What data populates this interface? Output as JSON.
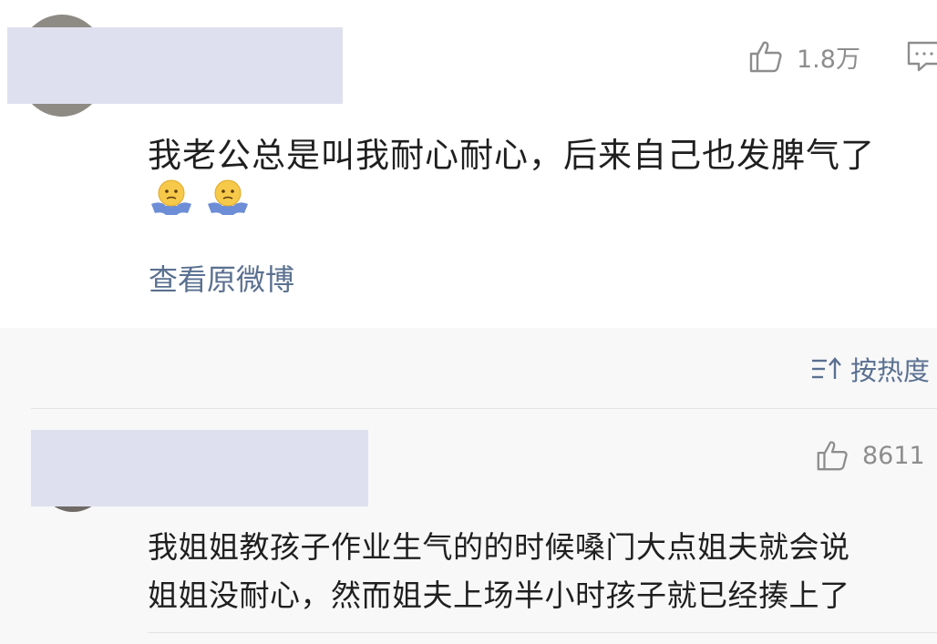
{
  "post": {
    "like_count": "1.8万",
    "text": "我老公总是叫我耐心耐心，后来自己也发脾气了",
    "emojis": [
      "shrug-emoji",
      "shrug-emoji"
    ],
    "view_original": "查看原微博"
  },
  "sort": {
    "label": "按热度"
  },
  "comment": {
    "like_count": "8611",
    "lines": [
      "我姐姐教孩子作业生气的的时候嗓门大点姐夫就会说",
      "姐姐没耐心，然而姐夫上场半小时孩子就已经揍上了"
    ]
  },
  "icons": {
    "like": "thumbs-up-icon",
    "comment": "comment-icon",
    "sort": "sort-icon"
  },
  "colors": {
    "link": "#5a7090",
    "muted": "#8d8d8d",
    "mask": "#dfe0ef",
    "comments_bg": "#f8f8f9"
  }
}
